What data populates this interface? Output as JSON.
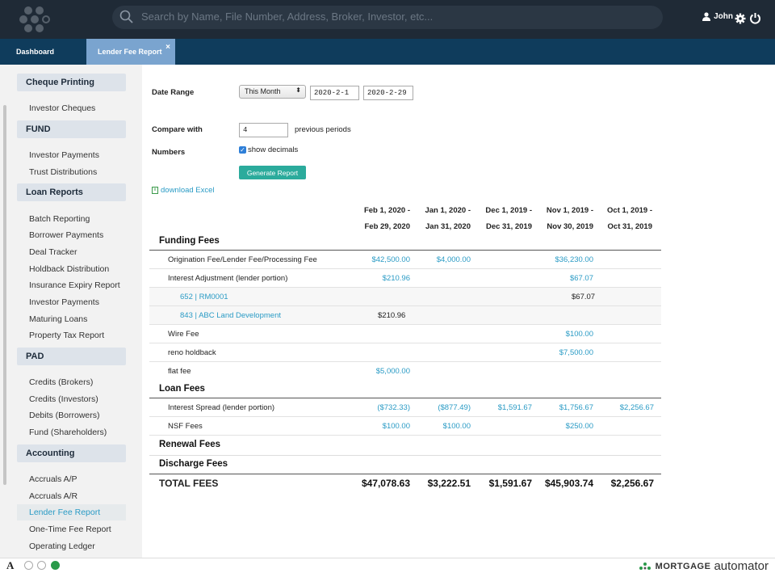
{
  "search": {
    "placeholder": "Search by Name, File Number, Address, Broker, Investor, etc..."
  },
  "user": {
    "name": "John"
  },
  "tabs": [
    {
      "label": "Dashboard"
    },
    {
      "label": "Lender Fee Report",
      "close": "×"
    }
  ],
  "sidebar": {
    "sections": [
      {
        "title": "Cheque Printing",
        "items": [
          "Investor Cheques"
        ]
      },
      {
        "title": "FUND",
        "items": [
          "Investor Payments",
          "Trust Distributions"
        ]
      },
      {
        "title": "Loan Reports",
        "items": [
          "Batch Reporting",
          "Borrower Payments",
          "Deal Tracker",
          "Holdback Distribution",
          "Insurance Expiry Report",
          "Investor Payments",
          "Maturing Loans",
          "Property Tax Report"
        ]
      },
      {
        "title": "PAD",
        "items": [
          "Credits (Brokers)",
          "Credits (Investors)",
          "Debits (Borrowers)",
          "Fund (Shareholders)"
        ]
      },
      {
        "title": "Accounting",
        "items": [
          "Accruals A/P",
          "Accruals A/R",
          "Lender Fee Report",
          "One-Time Fee Report",
          "Operating Ledger"
        ]
      }
    ],
    "active": "Lender Fee Report"
  },
  "form": {
    "date_range_label": "Date Range",
    "range_option": "This Month",
    "start_date": "2020-2-1",
    "end_date": "2020-2-29",
    "compare_label": "Compare with",
    "compare_value": "4",
    "previous_periods": "previous periods",
    "numbers_label": "Numbers",
    "show_decimals": "show decimals",
    "generate_button": "Generate Report",
    "download": "download Excel"
  },
  "report": {
    "columns": [
      {
        "line1": "Feb 1, 2020 -",
        "line2": "Feb 29, 2020"
      },
      {
        "line1": "Jan 1, 2020 -",
        "line2": "Jan 31, 2020"
      },
      {
        "line1": "Dec 1, 2019 -",
        "line2": "Dec 31, 2019"
      },
      {
        "line1": "Nov 1, 2019 -",
        "line2": "Nov 30, 2019"
      },
      {
        "line1": "Oct 1, 2019 -",
        "line2": "Oct 31, 2019"
      }
    ],
    "groups": {
      "funding": "Funding Fees",
      "loan": "Loan Fees",
      "renewal": "Renewal Fees",
      "discharge": "Discharge Fees"
    },
    "rows": [
      {
        "label": "Origination Fee/Lender Fee/Processing Fee",
        "values": [
          "$42,500.00",
          "$4,000.00",
          "",
          "$36,230.00",
          ""
        ]
      },
      {
        "label": "Interest Adjustment (lender portion)",
        "values": [
          "$210.96",
          "",
          "",
          "$67.07",
          ""
        ]
      },
      {
        "label": "652 | RM0001",
        "values": [
          "",
          "",
          "",
          "$67.07",
          ""
        ]
      },
      {
        "label": "843 | ABC Land Development",
        "values": [
          "$210.96",
          "",
          "",
          "",
          ""
        ]
      },
      {
        "label": "Wire Fee",
        "values": [
          "",
          "",
          "",
          "$100.00",
          ""
        ]
      },
      {
        "label": "reno holdback",
        "values": [
          "",
          "",
          "",
          "$7,500.00",
          ""
        ]
      },
      {
        "label": "flat fee",
        "values": [
          "$5,000.00",
          "",
          "",
          "",
          ""
        ]
      },
      {
        "label": "Interest Spread (lender portion)",
        "values": [
          "($732.33)",
          "($877.49)",
          "$1,591.67",
          "$1,756.67",
          "$2,256.67"
        ]
      },
      {
        "label": "NSF Fees",
        "values": [
          "$100.00",
          "$100.00",
          "",
          "$250.00",
          ""
        ]
      }
    ],
    "total_label": "TOTAL FEES",
    "totals": [
      "$47,078.63",
      "$3,222.51",
      "$1,591.67",
      "$45,903.74",
      "$2,256.67"
    ]
  },
  "footer": {
    "a": "A",
    "brand_bold": "MORTGAGE",
    "brand_rest": "automator"
  }
}
